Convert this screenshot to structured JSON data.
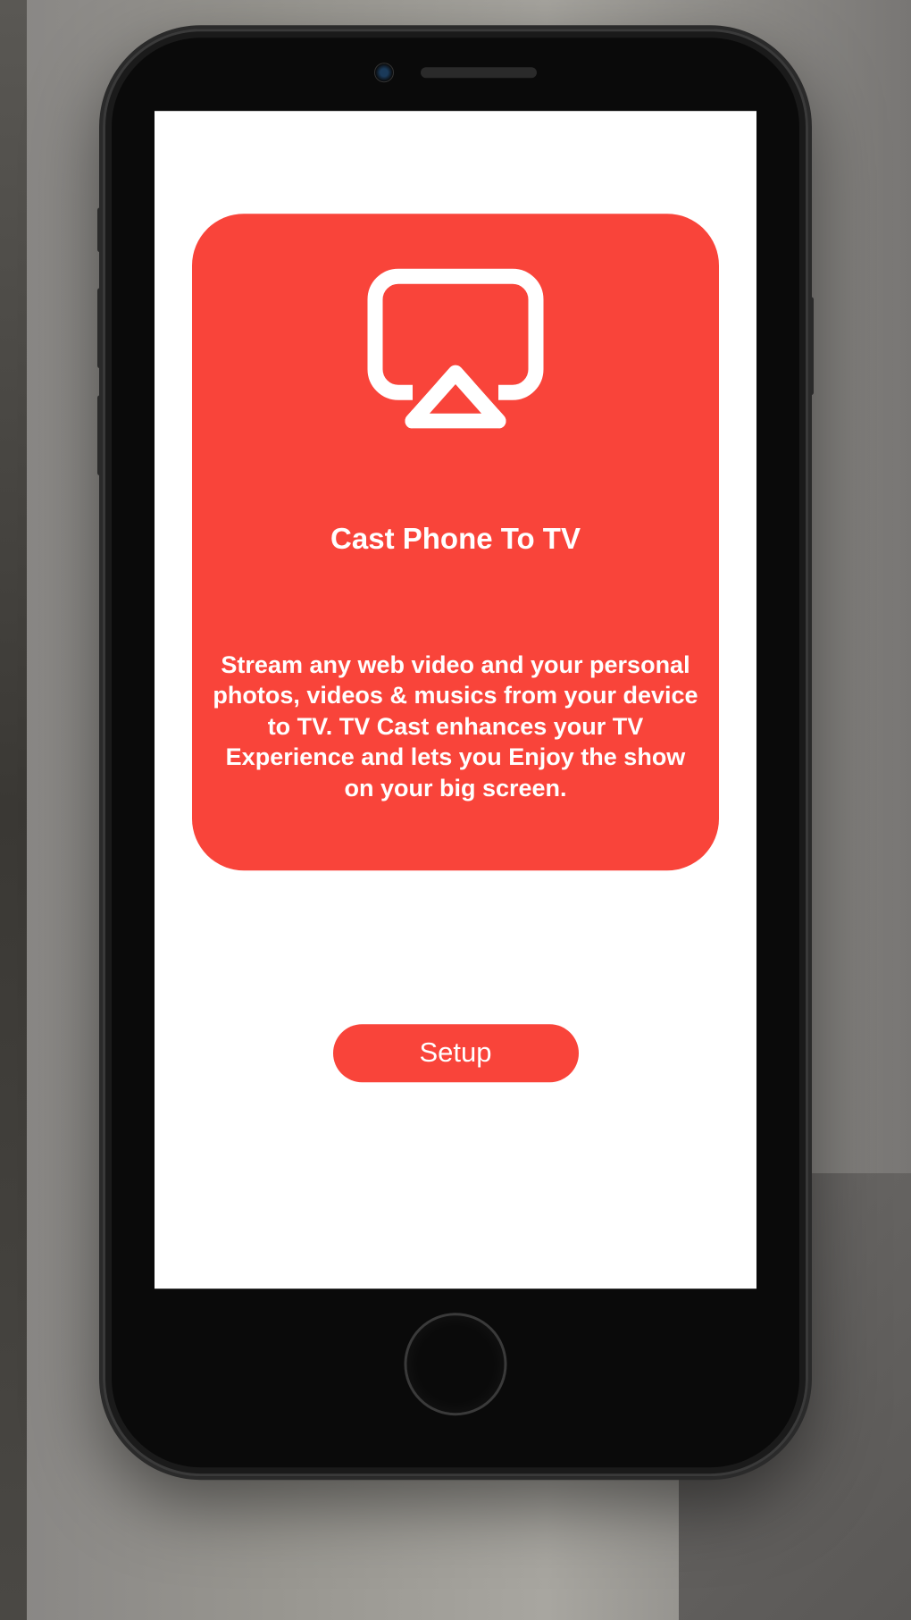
{
  "card": {
    "icon": "airplay-icon",
    "title": "Cast Phone To TV",
    "description": "Stream any web video and your personal photos, videos & musics from your device to TV. TV Cast enhances your TV Experience and lets you Enjoy the show on your big screen."
  },
  "button": {
    "setup_label": "Setup"
  },
  "colors": {
    "accent": "#f9443a",
    "text_on_accent": "#ffffff"
  }
}
